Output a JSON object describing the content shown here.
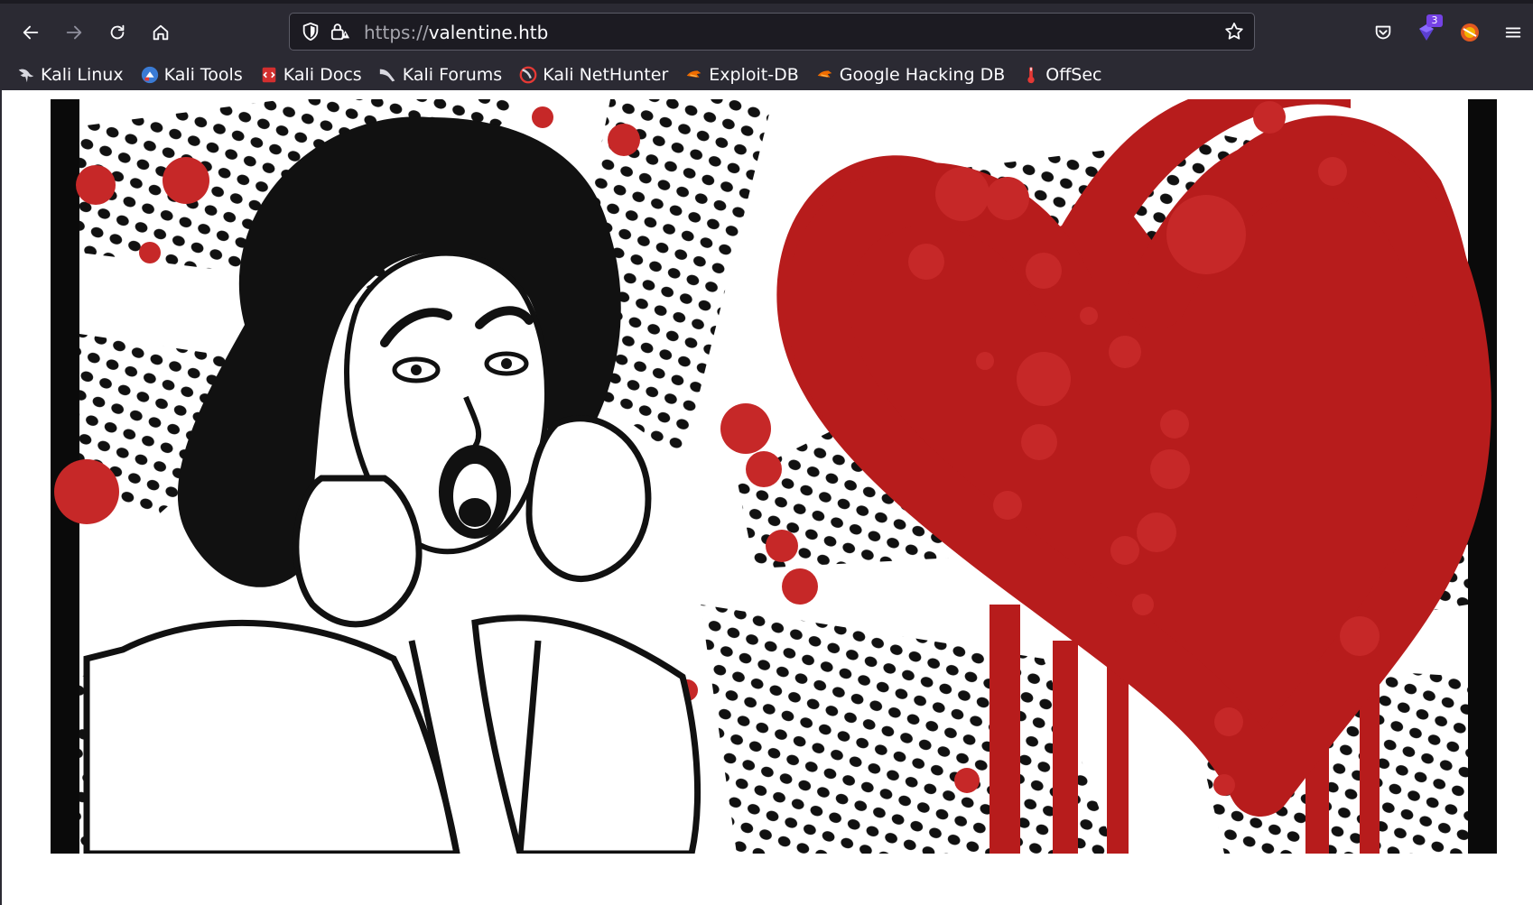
{
  "browser": {
    "url_scheme": "https://",
    "url_host": "valentine.htb",
    "extension_badge": "3"
  },
  "icons": {
    "back": "back-arrow-icon",
    "forward": "forward-arrow-icon",
    "reload": "reload-icon",
    "home": "home-icon",
    "shield": "tracking-protection-shield-icon",
    "lock": "insecure-lock-icon",
    "bookmark_star": "bookmark-star-icon",
    "pocket": "pocket-icon",
    "extension": "extension-icon",
    "account": "account-avatar-icon",
    "menu": "hamburger-menu-icon"
  },
  "bookmarks": [
    {
      "label": "Kali Linux",
      "icon": "kali-dragon-icon"
    },
    {
      "label": "Kali Tools",
      "icon": "kali-tools-icon"
    },
    {
      "label": "Kali Docs",
      "icon": "kali-docs-icon"
    },
    {
      "label": "Kali Forums",
      "icon": "kali-forums-icon"
    },
    {
      "label": "Kali NetHunter",
      "icon": "kali-nethunter-icon"
    },
    {
      "label": "Exploit-DB",
      "icon": "exploit-db-icon"
    },
    {
      "label": "Google Hacking DB",
      "icon": "google-hacking-db-icon"
    },
    {
      "label": "OffSec",
      "icon": "offsec-icon"
    }
  ],
  "colors": {
    "chrome_bg": "#2b2a33",
    "url_bg": "#1c1b22",
    "text": "#fbfbfe",
    "bleed_red": "#b71c1c",
    "ink": "#111111"
  },
  "page": {
    "hero_image": "omg-heartbleed-pop-art-illustration"
  }
}
